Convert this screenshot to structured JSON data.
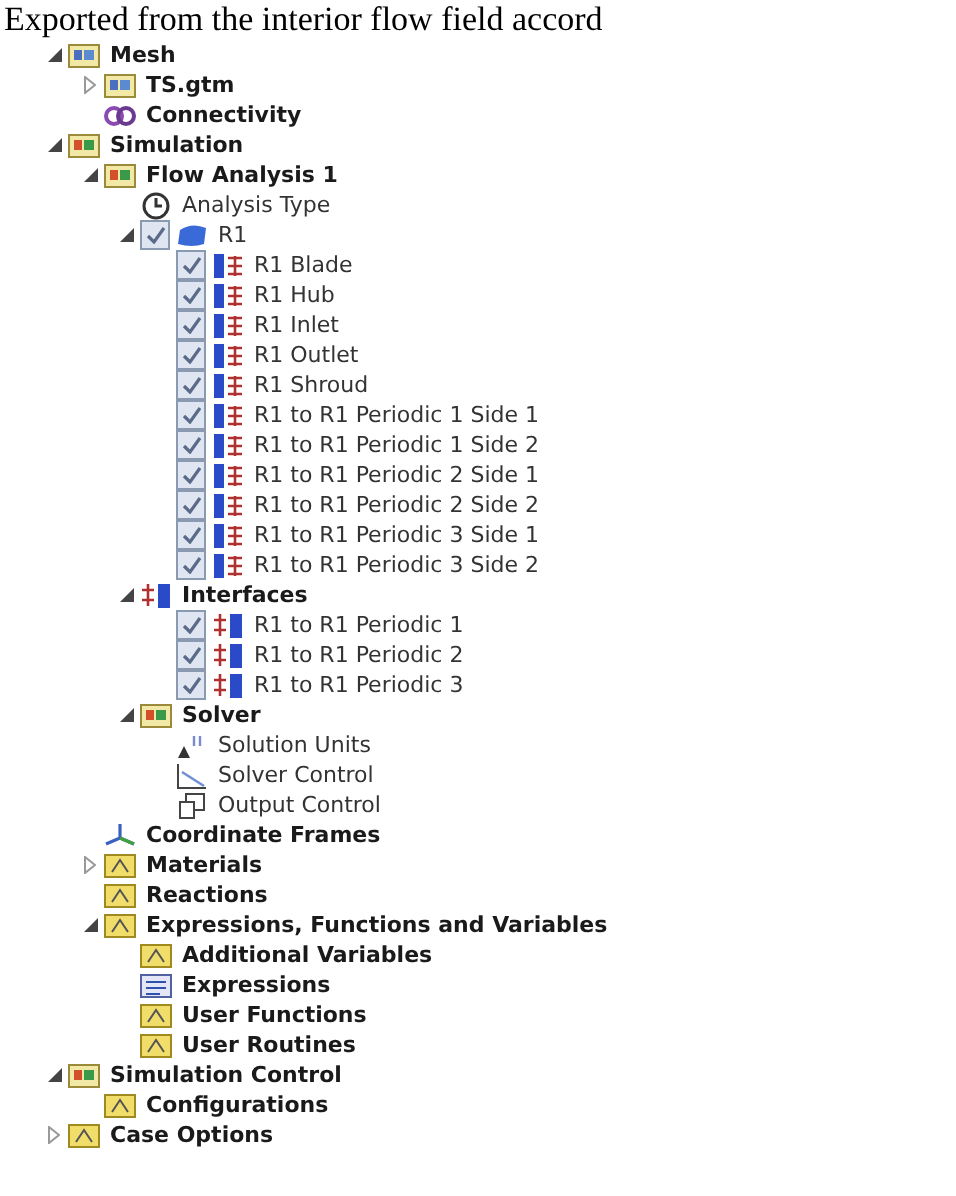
{
  "caption": "Exported from the interior flow field accord",
  "tree": [
    {
      "label": "Mesh",
      "kind": "mesh",
      "expanded": true,
      "children": [
        {
          "label": "TS.gtm",
          "kind": "mesh",
          "expanded": false
        },
        {
          "label": "Connectivity",
          "kind": "link"
        }
      ]
    },
    {
      "label": "Simulation",
      "kind": "sim",
      "expanded": true,
      "children": [
        {
          "label": "Flow Analysis 1",
          "kind": "sim",
          "expanded": true,
          "children": [
            {
              "label": "Analysis Type",
              "kind": "clock"
            },
            {
              "label": "R1",
              "kind": "domain",
              "checked": true,
              "expanded": true,
              "children": [
                {
                  "label": "R1 Blade",
                  "kind": "boundary",
                  "checked": true
                },
                {
                  "label": "R1 Hub",
                  "kind": "boundary",
                  "checked": true
                },
                {
                  "label": "R1 Inlet",
                  "kind": "boundary",
                  "checked": true
                },
                {
                  "label": "R1 Outlet",
                  "kind": "boundary",
                  "checked": true
                },
                {
                  "label": "R1 Shroud",
                  "kind": "boundary",
                  "checked": true
                },
                {
                  "label": "R1 to R1 Periodic 1 Side 1",
                  "kind": "boundary",
                  "checked": true
                },
                {
                  "label": "R1 to R1 Periodic 1 Side 2",
                  "kind": "boundary",
                  "checked": true
                },
                {
                  "label": "R1 to R1 Periodic 2 Side 1",
                  "kind": "boundary",
                  "checked": true
                },
                {
                  "label": "R1 to R1 Periodic 2 Side 2",
                  "kind": "boundary",
                  "checked": true
                },
                {
                  "label": "R1 to R1 Periodic 3 Side 1",
                  "kind": "boundary",
                  "checked": true
                },
                {
                  "label": "R1 to R1 Periodic 3 Side 2",
                  "kind": "boundary",
                  "checked": true
                }
              ]
            },
            {
              "label": "Interfaces",
              "kind": "interfaces",
              "expanded": true,
              "children": [
                {
                  "label": "R1 to R1 Periodic 1",
                  "kind": "interface",
                  "checked": true
                },
                {
                  "label": "R1 to R1 Periodic 2",
                  "kind": "interface",
                  "checked": true
                },
                {
                  "label": "R1 to R1 Periodic 3",
                  "kind": "interface",
                  "checked": true
                }
              ]
            },
            {
              "label": "Solver",
              "kind": "sim",
              "expanded": true,
              "children": [
                {
                  "label": "Solution Units",
                  "kind": "units"
                },
                {
                  "label": "Solver Control",
                  "kind": "control"
                },
                {
                  "label": "Output Control",
                  "kind": "output"
                }
              ]
            }
          ]
        },
        {
          "label": "Coordinate Frames",
          "kind": "axes"
        },
        {
          "label": "Materials",
          "kind": "folder",
          "expanded": false
        },
        {
          "label": "Reactions",
          "kind": "folder"
        },
        {
          "label": "Expressions, Functions and Variables",
          "kind": "folder",
          "expanded": true,
          "children": [
            {
              "label": "Additional Variables",
              "kind": "folder"
            },
            {
              "label": "Expressions",
              "kind": "list"
            },
            {
              "label": "User Functions",
              "kind": "folder"
            },
            {
              "label": "User Routines",
              "kind": "folder"
            }
          ]
        }
      ]
    },
    {
      "label": "Simulation Control",
      "kind": "sim",
      "expanded": true,
      "children": [
        {
          "label": "Configurations",
          "kind": "folder"
        }
      ]
    },
    {
      "label": "Case Options",
      "kind": "folder",
      "expanded": false
    }
  ]
}
